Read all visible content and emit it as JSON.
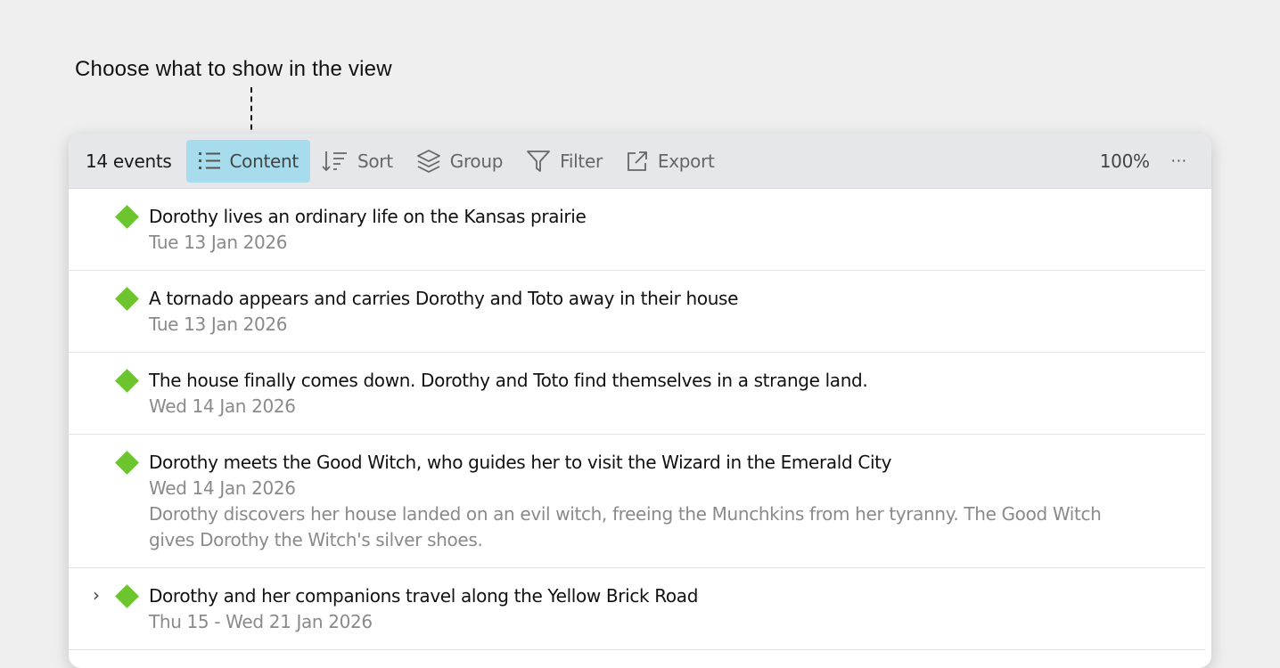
{
  "callout": {
    "text": "Choose what to show in the view"
  },
  "toolbar": {
    "count": "14 events",
    "content_label": "Content",
    "sort_label": "Sort",
    "group_label": "Group",
    "filter_label": "Filter",
    "export_label": "Export",
    "zoom": "100%",
    "more": "···"
  },
  "events": [
    {
      "title": "Dorothy lives an ordinary life on the Kansas prairie",
      "date": "Tue 13 Jan 2026"
    },
    {
      "title": "A tornado appears and carries Dorothy and Toto away in their house",
      "date": "Tue 13 Jan 2026"
    },
    {
      "title": "The house finally comes down. Dorothy and Toto find themselves in a strange land.",
      "date": "Wed 14 Jan 2026"
    },
    {
      "title": "Dorothy meets the Good Witch, who guides her to visit the Wizard in the Emerald City",
      "date": "Wed 14 Jan 2026",
      "description": "Dorothy discovers her house landed on an evil witch, freeing the Munchkins from her tyranny. The Good Witch gives Dorothy the Witch's silver shoes."
    },
    {
      "title": "Dorothy and her companions travel along the Yellow Brick Road",
      "date": "Thu 15 - Wed 21 Jan 2026",
      "chevron": "›"
    }
  ],
  "colors": {
    "accent": "#a7dcec",
    "event_marker": "#6cc52f",
    "toolbar_bg": "#e6e7ea"
  },
  "icons": [
    "list-icon",
    "sort-icon",
    "layers-icon",
    "filter-icon",
    "export-icon",
    "chevron-right-icon",
    "diamond-icon"
  ]
}
